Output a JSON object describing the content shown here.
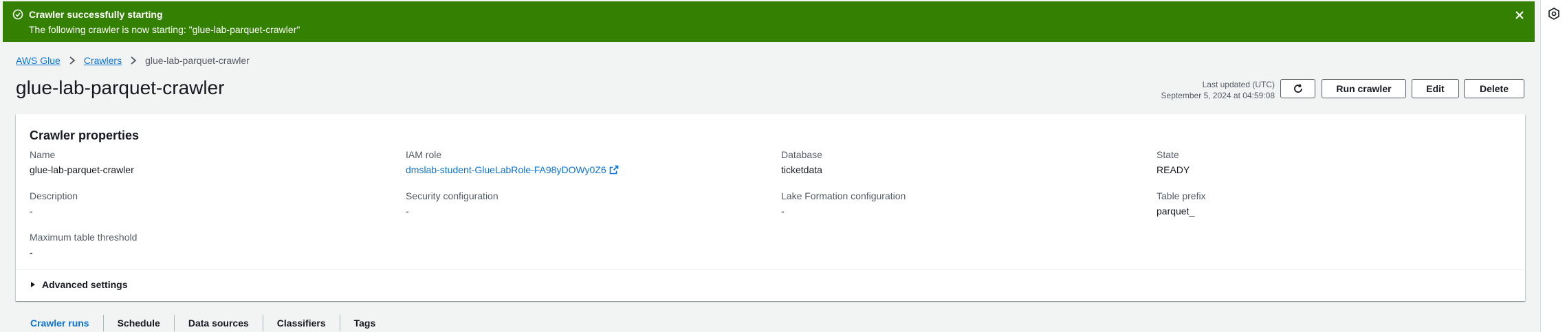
{
  "flash": {
    "title": "Crawler successfully starting",
    "message": "The following crawler is now starting: \"glue-lab-parquet-crawler\"",
    "icon": "check-circle-icon",
    "close_icon": "close-icon",
    "color": "#348002"
  },
  "breadcrumb": {
    "items": [
      "AWS Glue",
      "Crawlers"
    ],
    "current": "glue-lab-parquet-crawler"
  },
  "header": {
    "title": "glue-lab-parquet-crawler",
    "last_updated_label": "Last updated (UTC)",
    "last_updated_value": "September 5, 2024 at 04:59:08",
    "buttons": {
      "refresh_icon": "refresh-icon",
      "run": "Run crawler",
      "edit": "Edit",
      "delete": "Delete"
    }
  },
  "properties": {
    "title": "Crawler properties",
    "name": {
      "label": "Name",
      "value": "glue-lab-parquet-crawler"
    },
    "iam_role": {
      "label": "IAM role",
      "value": "dmslab-student-GlueLabRole-FA98yDOWy0Z6"
    },
    "database": {
      "label": "Database",
      "value": "ticketdata"
    },
    "state": {
      "label": "State",
      "value": "READY"
    },
    "description": {
      "label": "Description",
      "value": "-"
    },
    "security_configuration": {
      "label": "Security configuration",
      "value": "-"
    },
    "lake_formation": {
      "label": "Lake Formation configuration",
      "value": "-"
    },
    "table_prefix": {
      "label": "Table prefix",
      "value": "parquet_"
    },
    "max_table_threshold": {
      "label": "Maximum table threshold",
      "value": "-"
    },
    "advanced_settings": "Advanced settings"
  },
  "tabs": [
    "Crawler runs",
    "Schedule",
    "Data sources",
    "Classifiers",
    "Tags"
  ],
  "colors": {
    "link": "#0972d3",
    "background": "#f2f3f3",
    "text": "#16191f"
  }
}
